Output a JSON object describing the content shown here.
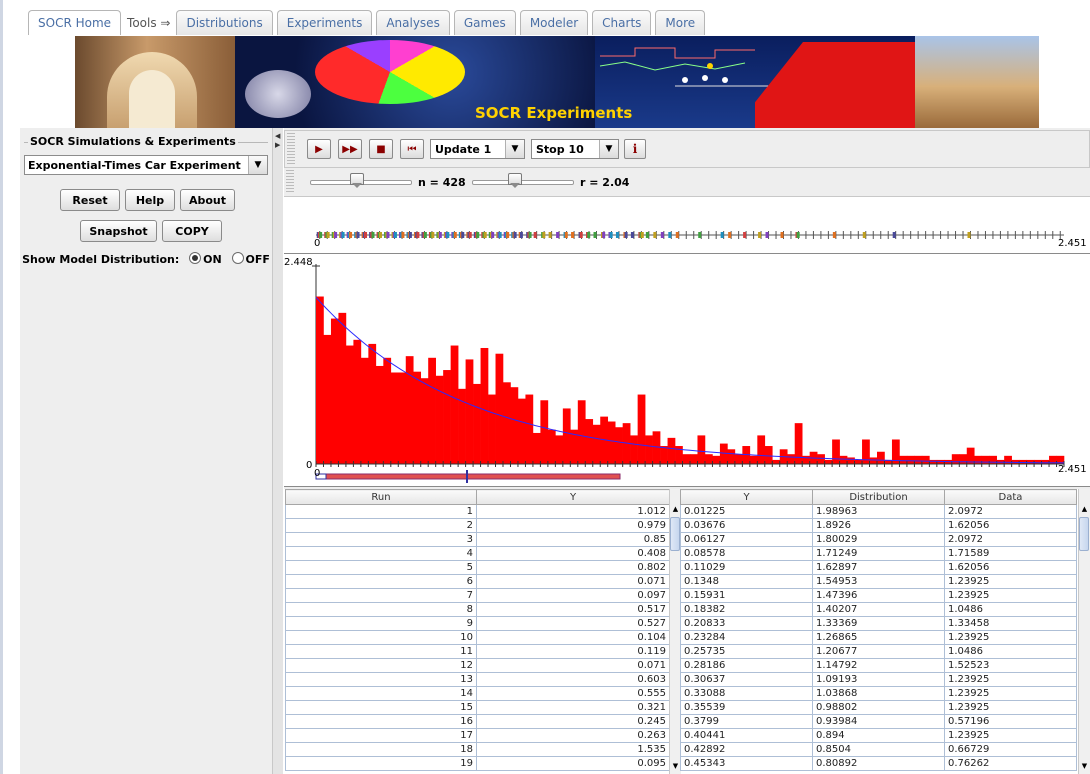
{
  "nav": {
    "tabs": [
      "SOCR Home",
      "Tools ⇒",
      "Distributions",
      "Experiments",
      "Analyses",
      "Games",
      "Modeler",
      "Charts",
      "More"
    ]
  },
  "banner": {
    "title": "SOCR Experiments"
  },
  "left": {
    "group_title": "SOCR Simulations & Experiments",
    "experiment": "Exponential-Times Car Experiment",
    "buttons": {
      "reset": "Reset",
      "help": "Help",
      "about": "About",
      "snapshot": "Snapshot",
      "copy": "COPY"
    },
    "show_model": "Show Model Distribution:",
    "on": "ON",
    "off": "OFF"
  },
  "toolbar": {
    "update": "Update 1",
    "stop": "Stop 10",
    "n_label": "n = 428",
    "r_label": "r = 2.04",
    "n_slider_value": 0.46,
    "r_slider_value": 0.42
  },
  "dotplot": {
    "min": "0",
    "max": "2.451"
  },
  "histogram": {
    "ymax": "2.448",
    "ymin": "0",
    "xmin": "0",
    "xmax": "2.451"
  },
  "chart_data": {
    "type": "bar",
    "xlim": [
      0,
      2.451
    ],
    "ylim": [
      0,
      2.448
    ],
    "bins": 100,
    "values": [
      2.05,
      1.58,
      1.78,
      1.85,
      1.45,
      1.52,
      1.3,
      1.47,
      1.2,
      1.3,
      1.12,
      1.12,
      1.32,
      1.13,
      1.05,
      1.3,
      1.08,
      1.15,
      1.45,
      0.92,
      1.28,
      0.98,
      1.42,
      0.85,
      1.35,
      1.0,
      0.94,
      0.8,
      0.85,
      0.38,
      0.78,
      0.42,
      0.35,
      0.68,
      0.42,
      0.78,
      0.55,
      0.48,
      0.58,
      0.52,
      0.45,
      0.5,
      0.35,
      0.85,
      0.35,
      0.4,
      0.22,
      0.32,
      0.22,
      0.12,
      0.12,
      0.35,
      0.12,
      0.1,
      0.25,
      0.18,
      0.12,
      0.22,
      0.1,
      0.35,
      0.22,
      0.05,
      0.18,
      0.12,
      0.5,
      0.1,
      0.15,
      0.12,
      0.05,
      0.3,
      0.1,
      0.08,
      0.05,
      0.3,
      0.08,
      0.15,
      0.05,
      0.3,
      0.1,
      0.1,
      0.1,
      0.1,
      0.05,
      0.05,
      0.05,
      0.12,
      0.12,
      0.2,
      0.1,
      0.1,
      0.1,
      0.05,
      0.1,
      0.05,
      0.05,
      0.05,
      0.05,
      0.05,
      0.1,
      0.1
    ],
    "model_curve": {
      "type": "exponential",
      "rate": 2.04
    }
  },
  "run_table": {
    "columns": [
      "Run",
      "Y"
    ],
    "rows": [
      [
        "1",
        "1.012"
      ],
      [
        "2",
        "0.979"
      ],
      [
        "3",
        "0.85"
      ],
      [
        "4",
        "0.408"
      ],
      [
        "5",
        "0.802"
      ],
      [
        "6",
        "0.071"
      ],
      [
        "7",
        "0.097"
      ],
      [
        "8",
        "0.517"
      ],
      [
        "9",
        "0.527"
      ],
      [
        "10",
        "0.104"
      ],
      [
        "11",
        "0.119"
      ],
      [
        "12",
        "0.071"
      ],
      [
        "13",
        "0.603"
      ],
      [
        "14",
        "0.555"
      ],
      [
        "15",
        "0.321"
      ],
      [
        "16",
        "0.245"
      ],
      [
        "17",
        "0.263"
      ],
      [
        "18",
        "1.535"
      ],
      [
        "19",
        "0.095"
      ]
    ]
  },
  "dist_table": {
    "columns": [
      "Y",
      "Distribution",
      "Data"
    ],
    "rows": [
      [
        "0.01225",
        "1.98963",
        "2.0972"
      ],
      [
        "0.03676",
        "1.8926",
        "1.62056"
      ],
      [
        "0.06127",
        "1.80029",
        "2.0972"
      ],
      [
        "0.08578",
        "1.71249",
        "1.71589"
      ],
      [
        "0.11029",
        "1.62897",
        "1.62056"
      ],
      [
        "0.1348",
        "1.54953",
        "1.23925"
      ],
      [
        "0.15931",
        "1.47396",
        "1.23925"
      ],
      [
        "0.18382",
        "1.40207",
        "1.0486"
      ],
      [
        "0.20833",
        "1.33369",
        "1.33458"
      ],
      [
        "0.23284",
        "1.26865",
        "1.23925"
      ],
      [
        "0.25735",
        "1.20677",
        "1.0486"
      ],
      [
        "0.28186",
        "1.14792",
        "1.52523"
      ],
      [
        "0.30637",
        "1.09193",
        "1.23925"
      ],
      [
        "0.33088",
        "1.03868",
        "1.23925"
      ],
      [
        "0.35539",
        "0.98802",
        "1.23925"
      ],
      [
        "0.3799",
        "0.93984",
        "0.57196"
      ],
      [
        "0.40441",
        "0.894",
        "1.23925"
      ],
      [
        "0.42892",
        "0.8504",
        "0.66729"
      ],
      [
        "0.45343",
        "0.80892",
        "0.76262"
      ]
    ]
  }
}
